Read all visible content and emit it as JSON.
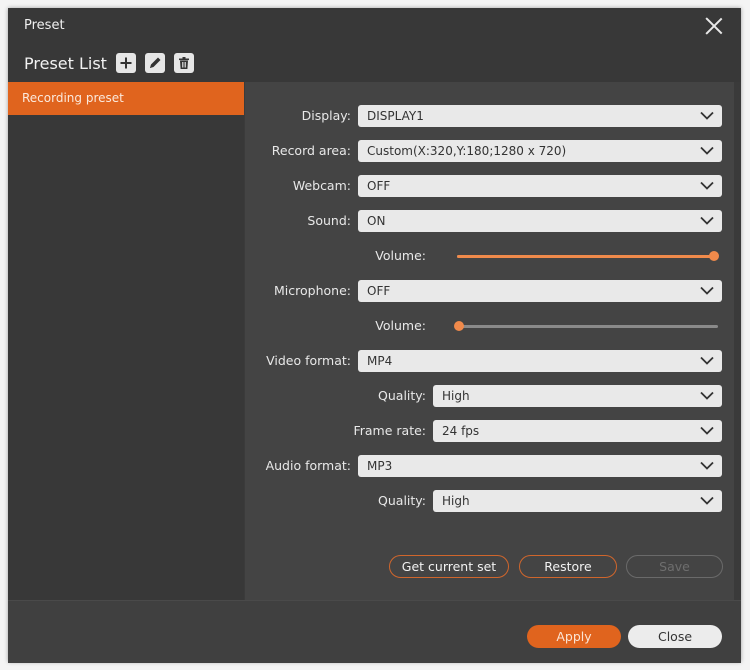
{
  "window": {
    "title": "Preset",
    "close_icon": "close-x-icon"
  },
  "preset_list": {
    "title": "Preset List",
    "tools": [
      {
        "name": "add",
        "icon": "plus-icon"
      },
      {
        "name": "edit",
        "icon": "pencil-icon"
      },
      {
        "name": "delete",
        "icon": "trash-icon"
      }
    ],
    "items": [
      {
        "label": "Recording preset",
        "selected": true
      }
    ]
  },
  "settings": {
    "display": {
      "label": "Display:",
      "value": "DISPLAY1"
    },
    "record_area": {
      "label": "Record area:",
      "value": "Custom(X:320,Y:180;1280 x 720)"
    },
    "webcam": {
      "label": "Webcam:",
      "value": "OFF"
    },
    "sound": {
      "label": "Sound:",
      "value": "ON"
    },
    "sound_volume": {
      "label": "Volume:",
      "value_percent": 100
    },
    "microphone": {
      "label": "Microphone:",
      "value": "OFF"
    },
    "mic_volume": {
      "label": "Volume:",
      "value_percent": 0
    },
    "video_format": {
      "label": "Video format:",
      "value": "MP4"
    },
    "video_quality": {
      "label": "Quality:",
      "value": "High"
    },
    "frame_rate": {
      "label": "Frame rate:",
      "value": "24 fps"
    },
    "audio_format": {
      "label": "Audio format:",
      "value": "MP3"
    },
    "audio_quality": {
      "label": "Quality:",
      "value": "High"
    }
  },
  "actions": {
    "get_current_set": "Get current set",
    "restore": "Restore",
    "save": "Save"
  },
  "footer": {
    "apply": "Apply",
    "close": "Close"
  },
  "colors": {
    "accent": "#e0641e",
    "slider": "#f08a4b",
    "background": "#444444",
    "sidebar": "#383838"
  }
}
